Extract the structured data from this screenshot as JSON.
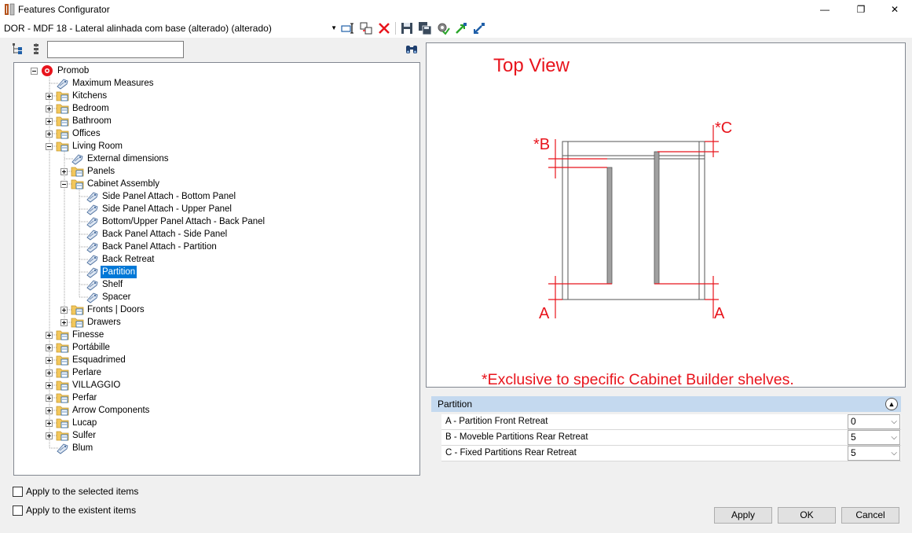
{
  "window": {
    "title": "Features Configurator",
    "minimize": "—",
    "maximize": "❐",
    "close": "✕"
  },
  "toolbar": {
    "profile": "DOR - MDF 18 - Lateral alinhada com base (alterado) (alterado)"
  },
  "search": {
    "value": "",
    "placeholder": ""
  },
  "tree": [
    {
      "label": "Promob",
      "level": 0,
      "expander": "minus",
      "icon": "promob-icon"
    },
    {
      "label": "Maximum Measures",
      "level": 1,
      "expander": "none",
      "icon": "tag-icon"
    },
    {
      "label": "Kitchens",
      "level": 1,
      "expander": "plus",
      "icon": "folder-icon"
    },
    {
      "label": "Bedroom",
      "level": 1,
      "expander": "plus",
      "icon": "folder-icon"
    },
    {
      "label": "Bathroom",
      "level": 1,
      "expander": "plus",
      "icon": "folder-icon"
    },
    {
      "label": "Offices",
      "level": 1,
      "expander": "plus",
      "icon": "folder-icon"
    },
    {
      "label": "Living Room",
      "level": 1,
      "expander": "minus",
      "icon": "folder-icon"
    },
    {
      "label": "External dimensions",
      "level": 2,
      "expander": "none",
      "icon": "tag-icon"
    },
    {
      "label": "Panels",
      "level": 2,
      "expander": "plus",
      "icon": "folder-icon"
    },
    {
      "label": "Cabinet Assembly",
      "level": 2,
      "expander": "minus",
      "icon": "folder-icon"
    },
    {
      "label": "Side Panel Attach - Bottom Panel",
      "level": 3,
      "expander": "none",
      "icon": "tag-icon"
    },
    {
      "label": " Side Panel Attach - Upper Panel",
      "level": 3,
      "expander": "none",
      "icon": "tag-icon"
    },
    {
      "label": " Bottom/Upper Panel Attach - Back Panel",
      "level": 3,
      "expander": "none",
      "icon": "tag-icon"
    },
    {
      "label": "Back Panel Attach - Side Panel",
      "level": 3,
      "expander": "none",
      "icon": "tag-icon"
    },
    {
      "label": "Back Panel Attach - Partition",
      "level": 3,
      "expander": "none",
      "icon": "tag-icon"
    },
    {
      "label": "Back Retreat",
      "level": 3,
      "expander": "none",
      "icon": "tag-icon"
    },
    {
      "label": "Partition",
      "level": 3,
      "expander": "none",
      "icon": "tag-icon",
      "selected": true
    },
    {
      "label": "Shelf",
      "level": 3,
      "expander": "none",
      "icon": "tag-icon"
    },
    {
      "label": " Spacer",
      "level": 3,
      "expander": "none",
      "icon": "tag-icon"
    },
    {
      "label": "Fronts | Doors",
      "level": 2,
      "expander": "plus",
      "icon": "folder-icon"
    },
    {
      "label": "Drawers",
      "level": 2,
      "expander": "plus",
      "icon": "folder-icon"
    },
    {
      "label": "Finesse",
      "level": 1,
      "expander": "plus",
      "icon": "folder-icon"
    },
    {
      "label": "Portábille",
      "level": 1,
      "expander": "plus",
      "icon": "folder-icon"
    },
    {
      "label": "Esquadrimed",
      "level": 1,
      "expander": "plus",
      "icon": "folder-icon"
    },
    {
      "label": "Perlare",
      "level": 1,
      "expander": "plus",
      "icon": "folder-icon"
    },
    {
      "label": "VILLAGGIO",
      "level": 1,
      "expander": "plus",
      "icon": "folder-icon"
    },
    {
      "label": "Perfar",
      "level": 1,
      "expander": "plus",
      "icon": "folder-icon"
    },
    {
      "label": "Arrow Components",
      "level": 1,
      "expander": "plus",
      "icon": "folder-icon"
    },
    {
      "label": "Lucap",
      "level": 1,
      "expander": "plus",
      "icon": "folder-icon"
    },
    {
      "label": "Sulfer",
      "level": 1,
      "expander": "plus",
      "icon": "folder-icon"
    },
    {
      "label": "Blum",
      "level": 1,
      "expander": "none",
      "icon": "tag-icon"
    }
  ],
  "options": {
    "apply_selected": "Apply to the selected items",
    "apply_existent": "Apply to the existent items"
  },
  "preview": {
    "title": "Top View",
    "label_a_left": "A",
    "label_a_right": "A",
    "label_b": "*B",
    "label_c": "*C",
    "note": "*Exclusive to specific Cabinet Builder shelves.",
    "accent_color": "#e8141c"
  },
  "properties": {
    "section": "Partition",
    "rows": [
      {
        "label": "A - Partition Front Retreat",
        "value": "0"
      },
      {
        "label": "B - Moveble Partitions Rear Retreat",
        "value": "5"
      },
      {
        "label": "C - Fixed Partitions Rear Retreat",
        "value": "5"
      }
    ]
  },
  "buttons": {
    "apply": "Apply",
    "ok": "OK",
    "cancel": "Cancel"
  }
}
